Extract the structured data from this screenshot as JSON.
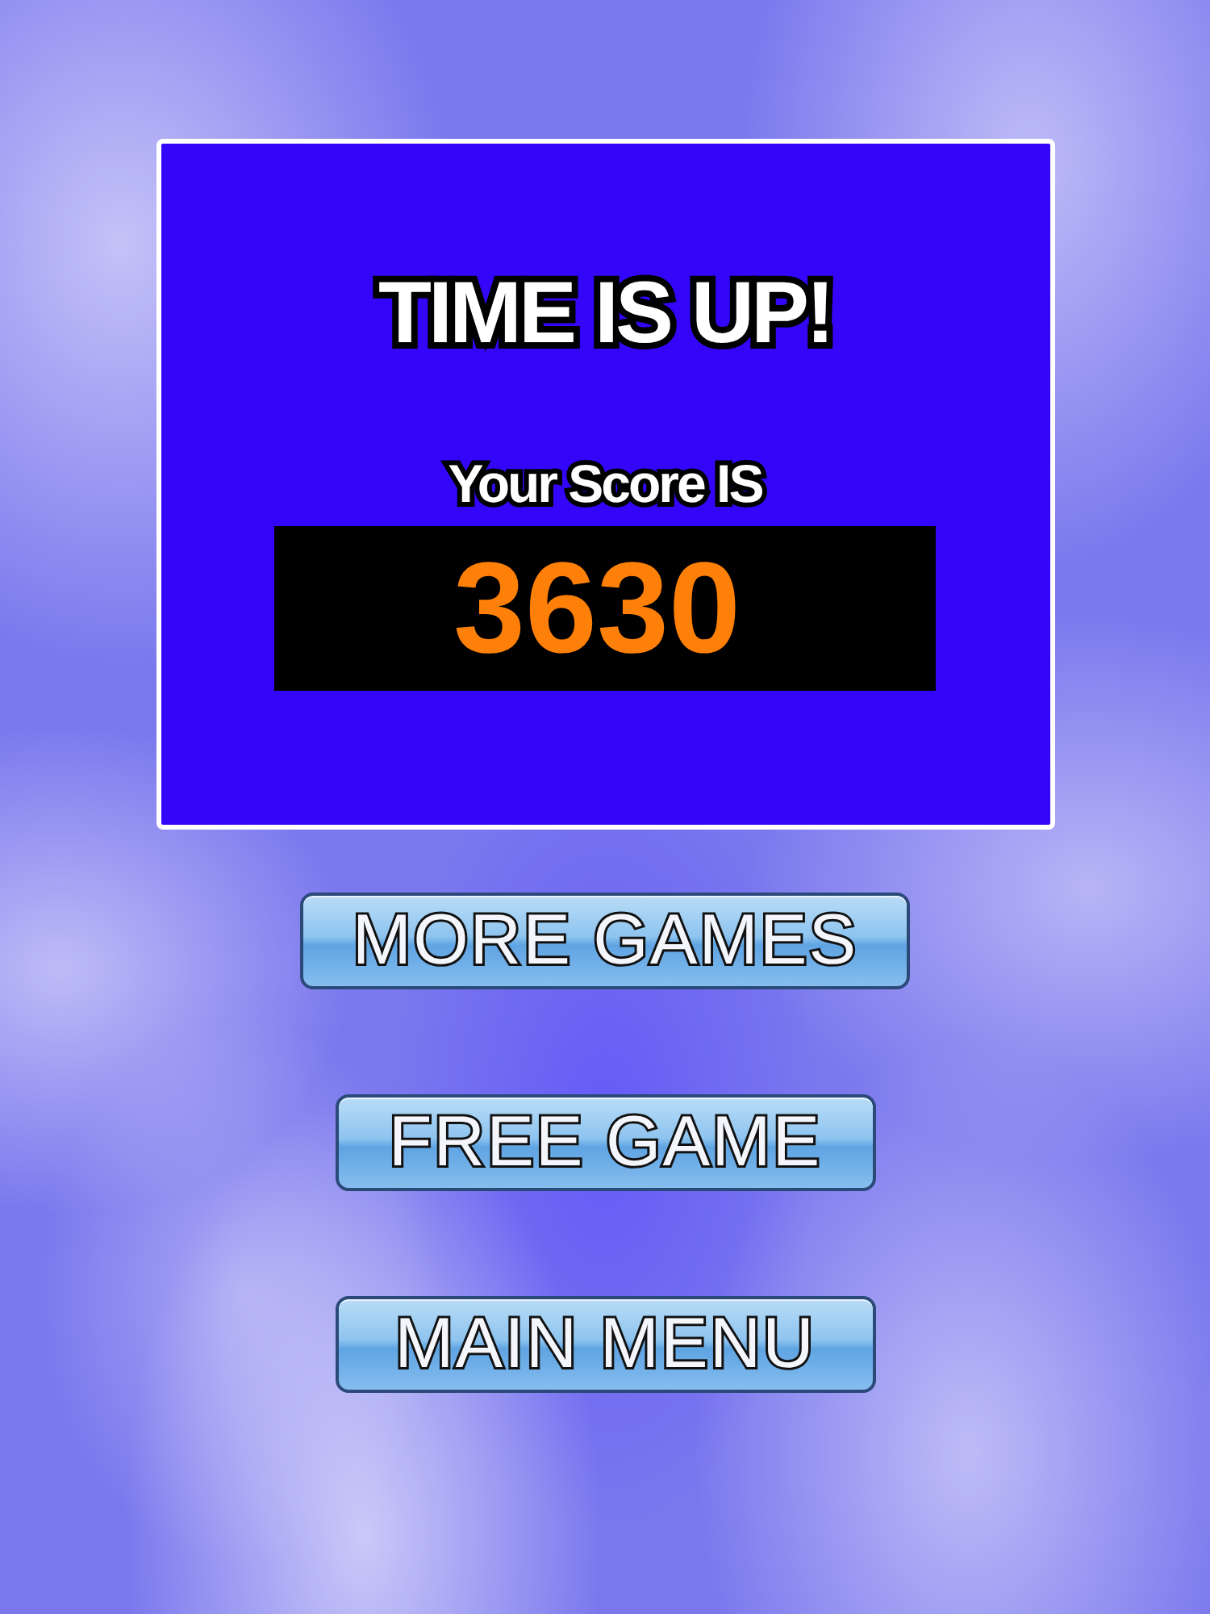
{
  "result_panel": {
    "title": "TIME IS UP!",
    "score_label": "Your Score IS",
    "score": "3630"
  },
  "buttons": [
    {
      "label": "MORE GAMES"
    },
    {
      "label": "FREE GAME"
    },
    {
      "label": "MAIN MENU"
    }
  ]
}
